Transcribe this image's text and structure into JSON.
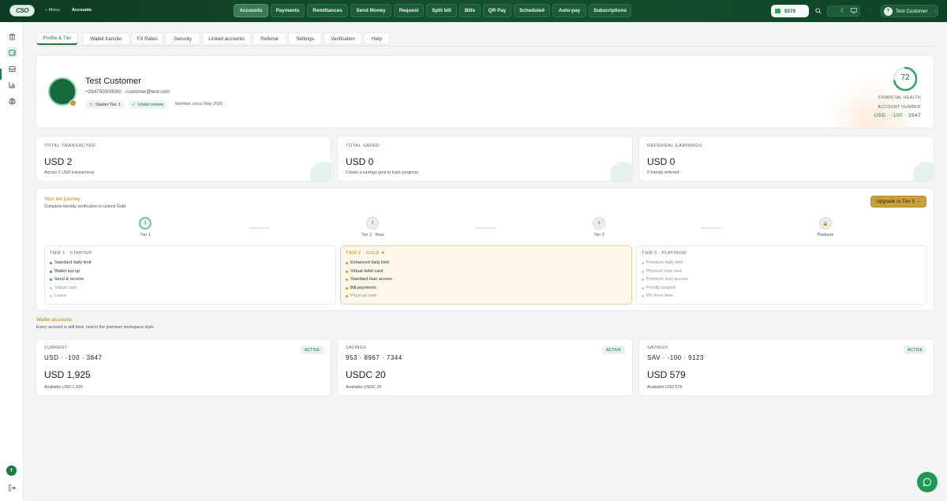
{
  "app": {
    "logo_text": "CSO",
    "brand_color": "#1a7a45"
  },
  "header": {
    "breadcrumb_parent": "Menu",
    "breadcrumb_current": "Accounts",
    "nav": [
      "Accounts",
      "Payments",
      "Remittances",
      "Send Money",
      "Request",
      "Split bill",
      "Bills",
      "QR Pay",
      "Scheduled",
      "Auto-pay",
      "Subscriptions"
    ],
    "active_nav": "Accounts",
    "balance": "$579",
    "user_name": "Test Customer",
    "user_initial": "T"
  },
  "sidebar": {
    "icons": [
      "bank-icon",
      "wallet-icon",
      "inbox-icon",
      "chart-icon",
      "user-circle-icon"
    ],
    "avatar_initial": "T"
  },
  "tabs": [
    "Profile & Tier",
    "Wallet transfer",
    "FX Rates",
    "Security",
    "Linked accounts",
    "Referral",
    "Settings",
    "Verification",
    "Help"
  ],
  "profile": {
    "name": "Test Customer",
    "contact": "+254700000000 · customer@test.com",
    "tier_chip": "Starter Tier 1",
    "status_chip": "Under review",
    "member_since": "Member since May 2026",
    "health_score": "72",
    "health_fraction": 0.72,
    "health_label": "FINANCIAL HEALTH",
    "account_label": "ACCOUNT NUMBER",
    "account_number": "USD · -100 · 3847"
  },
  "stats": [
    {
      "label": "TOTAL TRANSACTED",
      "value": "USD 2",
      "sub": "Across 2 USD transactions"
    },
    {
      "label": "TOTAL SAVED",
      "value": "USD 0",
      "sub": "Create a savings goal to track progress"
    },
    {
      "label": "REFERRAL EARNINGS",
      "value": "USD 0",
      "sub": "0 friends referred"
    }
  ],
  "journey": {
    "title": "Your tier journey",
    "subtitle": "Complete identity verification to unlock Gold",
    "upgrade_label": "Upgrade to Tier 3 →",
    "steps": [
      {
        "num": "1",
        "label": "Tier 1"
      },
      {
        "num": "2",
        "label": "Tier 2 · Now"
      },
      {
        "num": "3",
        "label": "Tier 3"
      },
      {
        "num": "🔒",
        "label": "Platinum"
      }
    ],
    "tiers": [
      {
        "head": "TIER 1 · STARTER",
        "features": [
          "Standard daily limit",
          "Wallet top-up",
          "Send & receive",
          "Virtual card",
          "Loans"
        ]
      },
      {
        "head": "TIER 2 · GOLD ★",
        "features": [
          "Enhanced daily limit",
          "Virtual debit card",
          "Standard loan access",
          "Bill payments",
          "Physical card"
        ]
      },
      {
        "head": "TIER 3 · PLATINUM",
        "features": [
          "Premium daily limit",
          "Physical Visa card",
          "Premium loan access",
          "Priority support",
          "0% forex fees"
        ]
      }
    ]
  },
  "wallets": {
    "title": "Wallet accounts",
    "subtitle": "Every account is still here, now in the premium workspace style.",
    "items": [
      {
        "type": "CURRENT",
        "number": "USD · -100 · 3847",
        "balance": "USD 1,925",
        "available": "Available USD 1,925",
        "status": "ACTIVE"
      },
      {
        "type": "SAVINGS",
        "number": "953 · 8967 · 7344",
        "balance": "USDC 20",
        "available": "Available USDC 20",
        "status": "ACTIVE"
      },
      {
        "type": "SAVINGS",
        "number": "SAV · -100 · 9123",
        "balance": "USD 579",
        "available": "Available USD 579",
        "status": "ACTIVE"
      }
    ]
  }
}
